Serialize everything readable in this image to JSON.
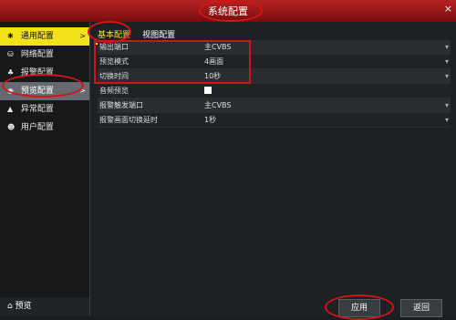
{
  "window": {
    "title": "系统配置",
    "close": "×"
  },
  "sidebar": {
    "items": [
      {
        "icon": "✱",
        "label": "通用配置",
        "arrow": ">"
      },
      {
        "icon": "⛁",
        "label": "网络配置"
      },
      {
        "icon": "♣",
        "label": "报警配置"
      },
      {
        "icon": "◉",
        "label": "预览配置",
        "arrow": ">"
      },
      {
        "icon": "▲",
        "label": "异常配置"
      },
      {
        "icon": "☻",
        "label": "用户配置"
      }
    ],
    "bottom": {
      "icon": "⌂",
      "label": "预览"
    }
  },
  "tabs": [
    {
      "label": "基本配置"
    },
    {
      "label": "视图配置"
    }
  ],
  "rows": [
    {
      "label": "输出端口",
      "value": "主CVBS",
      "dropdown": true
    },
    {
      "label": "预览模式",
      "value": "4画面",
      "dropdown": true
    },
    {
      "label": "切换时间",
      "value": "10秒",
      "dropdown": true
    },
    {
      "label": "音频预览",
      "value": "",
      "checkbox": true
    },
    {
      "label": "报警触发端口",
      "value": "主CVBS",
      "dropdown": true
    },
    {
      "label": "报警画面切换延时",
      "value": "1秒",
      "dropdown": true
    }
  ],
  "buttons": {
    "apply": "应用",
    "back": "返回"
  },
  "colors": {
    "accent": "#f3e21a",
    "title_bar": "#a11a1a",
    "highlight_ring": "#d21414"
  }
}
